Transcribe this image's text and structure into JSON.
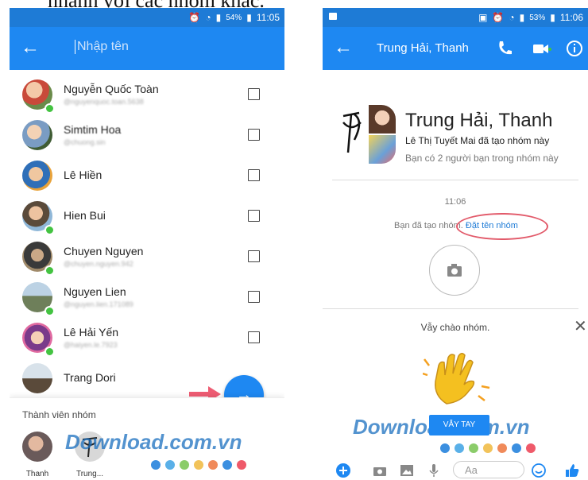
{
  "caption": "nhanh với các nhóm khác.",
  "left_screen": {
    "status": {
      "battery_pct": "54%",
      "time": "11:05"
    },
    "search": {
      "placeholder": "Nhập tên"
    },
    "contacts": [
      {
        "name": "Nguyễn Quốc Toàn",
        "handle": "@nguyenquoc.toan.5638",
        "online": true
      },
      {
        "name": "Simtim Hoa",
        "handle": "@chuong.sin",
        "online": false
      },
      {
        "name": "Lê Hiền",
        "handle": "",
        "online": false
      },
      {
        "name": "Hien Bui",
        "handle": "",
        "online": true
      },
      {
        "name": "Chuyen Nguyen",
        "handle": "@chuyen.nguyen.942",
        "online": true
      },
      {
        "name": "Nguyen Lien",
        "handle": "@nguyen.lien.171089",
        "online": true
      },
      {
        "name": "Lê Hải Yến",
        "handle": "@haiyen.le.7923",
        "online": true
      },
      {
        "name": "Trang Dori",
        "handle": "",
        "online": false
      }
    ],
    "members_label": "Thành viên nhóm",
    "members": [
      {
        "name": "Thanh"
      },
      {
        "name": "Trung..."
      }
    ],
    "watermark": "Download.com.vn"
  },
  "right_screen": {
    "status": {
      "battery_pct": "53%",
      "time": "11:06"
    },
    "title": "Trung Hải, Thanh",
    "group_name": "Trung Hải, Thanh",
    "creator_line": "Lê Thị Tuyết Mai đã tạo nhóm này",
    "friends_line": "Bạn có 2 người bạn trong nhóm này",
    "time": "11:06",
    "event_text": "Bạn đã tạo nhóm.",
    "event_link": "Đặt tên nhóm",
    "wave_text": "Vẫy chào nhóm.",
    "wave_button": "VẪY TAY",
    "composer_placeholder": "Aa",
    "watermark": "Download.com.vn"
  },
  "colors": {
    "brand": "#1e88f2",
    "status_bar": "#1e7bd6",
    "online": "#43c341",
    "highlight": "#e25a6a"
  },
  "watermark_dots": [
    "#3b8fe0",
    "#5ab0e8",
    "#8bcc6a",
    "#f2c35a",
    "#f08a5a",
    "#3b8fe0",
    "#ef5a6a"
  ]
}
